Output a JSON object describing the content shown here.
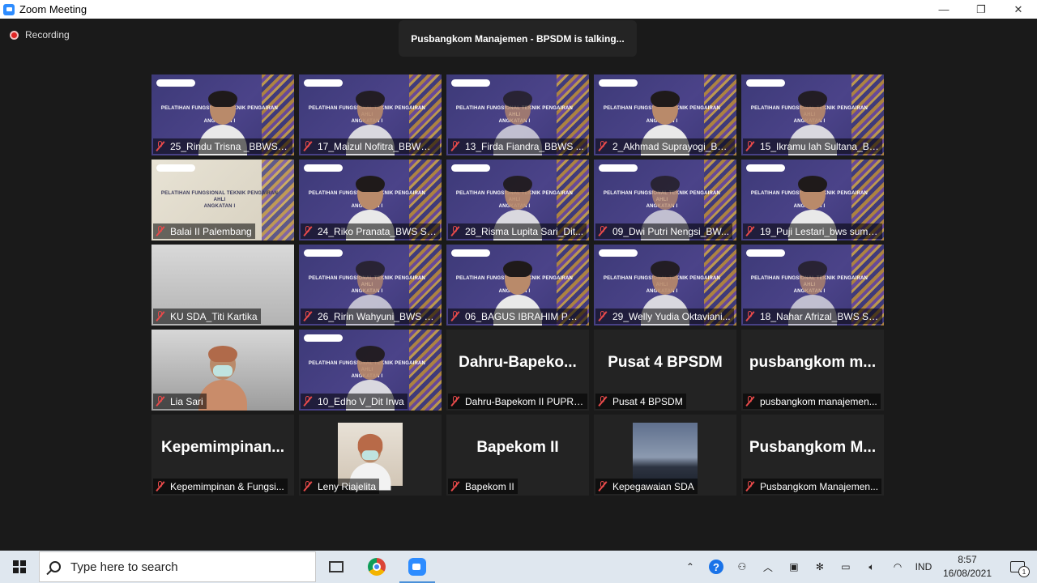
{
  "window": {
    "title": "Zoom Meeting",
    "minimize": "—",
    "restore": "❐",
    "close": "✕"
  },
  "recording": {
    "label": "Recording"
  },
  "talking": {
    "text": "Pusbangkom Manajemen - BPSDM is talking..."
  },
  "slide": {
    "title_line1": "PELATIHAN FUNGSIONAL TEKNIK PENGAIRAN AHLI",
    "title_line2": "ANGKATAN I"
  },
  "tiles": [
    {
      "name": "25_Rindu Trisna _BBWS MS",
      "kind": "slide"
    },
    {
      "name": "17_Maizul Nofitra_BBWS ...",
      "kind": "slide"
    },
    {
      "name": "13_Firda Fiandra_BBWS ...",
      "kind": "slide"
    },
    {
      "name": "2_Akhmad Suprayogi_BW...",
      "kind": "slide"
    },
    {
      "name": "15_Ikramu lah Sultana_BP...",
      "kind": "slide"
    },
    {
      "name": "Balai II Palembang",
      "kind": "beige"
    },
    {
      "name": "24_Riko Pranata_BWS Su...",
      "kind": "slide"
    },
    {
      "name": "28_Risma Lupita Sari_Dit...",
      "kind": "slide"
    },
    {
      "name": "09_Dwi Putri Nengsi_BW...",
      "kind": "slide"
    },
    {
      "name": "19_Puji Lestari_bws suma...",
      "kind": "slide"
    },
    {
      "name": "KU SDA_Titi Kartika",
      "kind": "cam-grey"
    },
    {
      "name": "26_Ririn Wahyuni_BWS S...",
      "kind": "slide"
    },
    {
      "name": "06_BAGUS IBRAHIM PRIJ...",
      "kind": "slide"
    },
    {
      "name": "29_Welly Yudia Oktaviani...",
      "kind": "slide"
    },
    {
      "name": "18_Nahar Afrizal_BWS Su...",
      "kind": "slide"
    },
    {
      "name": "Lia Sari",
      "kind": "cam-room"
    },
    {
      "name": "10_Edho V_Dit Irwa",
      "kind": "slide"
    },
    {
      "name": "Dahru-Bapekom II PUPR ...",
      "kind": "dark",
      "big": "Dahru-Bapeko..."
    },
    {
      "name": "Pusat 4 BPSDM",
      "kind": "dark",
      "big": "Pusat 4 BPSDM"
    },
    {
      "name": "pusbangkom manajemen...",
      "kind": "dark",
      "big": "pusbangkom  m..."
    },
    {
      "name": "Kepemimpinan & Fungsi...",
      "kind": "dark",
      "big": "Kepemimpinan..."
    },
    {
      "name": "Leny Riajelita",
      "kind": "thumb-leny"
    },
    {
      "name": "Bapekom II",
      "kind": "dark",
      "big": "Bapekom II"
    },
    {
      "name": "Kepegawaian SDA",
      "kind": "thumb-sky"
    },
    {
      "name": "Pusbangkom Manajemen...",
      "kind": "dark",
      "big": "Pusbangkom  M..."
    }
  ],
  "taskbar": {
    "search_placeholder": "Type here to search",
    "lang": "IND",
    "time": "8:57",
    "date": "16/08/2021",
    "notif_count": "1"
  }
}
